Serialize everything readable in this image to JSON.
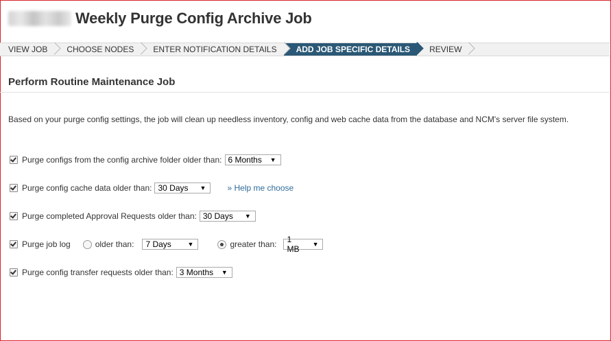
{
  "page": {
    "title": "Weekly Purge Config Archive Job"
  },
  "wizard": {
    "steps": [
      {
        "label": "VIEW JOB",
        "active": false
      },
      {
        "label": "CHOOSE NODES",
        "active": false
      },
      {
        "label": "ENTER NOTIFICATION DETAILS",
        "active": false
      },
      {
        "label": "ADD JOB SPECIFIC DETAILS",
        "active": true
      },
      {
        "label": "REVIEW",
        "active": false
      }
    ]
  },
  "section": {
    "title": "Perform Routine Maintenance Job",
    "description": "Based on your purge config settings, the job will clean up needless inventory, config and web cache data from the database and NCM's server file system."
  },
  "options": {
    "purge_configs": {
      "label": "Purge configs from the config archive folder older than:",
      "checked": true,
      "value": "6 Months"
    },
    "purge_cache": {
      "label": "Purge config cache data older than:",
      "checked": true,
      "value": "30 Days",
      "help_link": "» Help me choose"
    },
    "purge_approval": {
      "label": "Purge completed Approval Requests older than:",
      "checked": true,
      "value": "30 Days"
    },
    "purge_log": {
      "label": "Purge job log",
      "checked": true,
      "older_label": "older than:",
      "older_value": "7 Days",
      "older_selected": false,
      "greater_label": "greater than:",
      "greater_value": "1 MB",
      "greater_selected": true
    },
    "purge_transfer": {
      "label": "Purge config transfer requests older than:",
      "checked": true,
      "value": "3 Months"
    }
  },
  "colors": {
    "active_step": "#2b5876",
    "link": "#2f6b9a",
    "frame": "#d9232e"
  }
}
